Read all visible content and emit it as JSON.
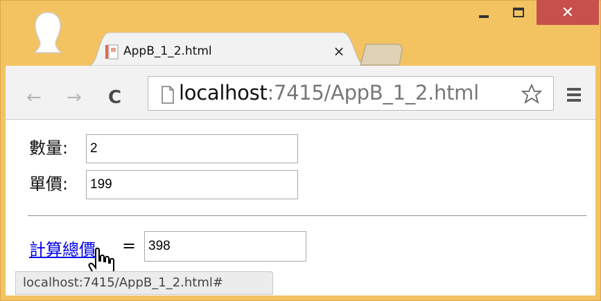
{
  "window": {
    "minimize_icon": "minimize-icon",
    "maximize_icon": "maximize-icon",
    "close_glyph": "✕",
    "close_color": "#c7504c"
  },
  "tab": {
    "title": "AppB_1_2.html",
    "close_glyph": "×"
  },
  "toolbar": {
    "back_glyph": "←",
    "forward_glyph": "→",
    "reload_glyph": "C",
    "url_host": "localhost",
    "url_rest": ":7415/AppB_1_2.html"
  },
  "form": {
    "quantity_label": "數量:",
    "quantity_value": "2",
    "price_label": "單價:",
    "price_value": "199",
    "calc_link": "計算總價",
    "equals": "=",
    "total_value": "398"
  },
  "status_bar": {
    "text": "localhost:7415/AppB_1_2.html#"
  },
  "colors": {
    "frame": "#f3c362",
    "link": "#0000ee",
    "toolbar": "#f2f2f2"
  }
}
